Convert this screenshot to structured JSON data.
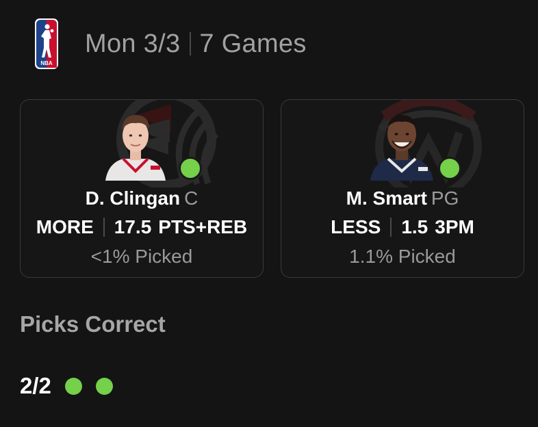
{
  "header": {
    "logo_icon": "nba-logo",
    "date": "Mon 3/3",
    "games": "7 Games"
  },
  "cards": [
    {
      "player_name": "D. Clingan",
      "position": "C",
      "direction": "MORE",
      "line": "17.5",
      "stat": "PTS+REB",
      "picked": "<1% Picked",
      "status": "correct",
      "team_logo_icon": "trail-blazers-pinwheel-logo",
      "status_color": "#75d04a"
    },
    {
      "player_name": "M. Smart",
      "position": "PG",
      "direction": "LESS",
      "line": "1.5",
      "stat": "3PM",
      "picked": "1.1% Picked",
      "status": "correct",
      "team_logo_icon": "wizards-logo",
      "status_color": "#75d04a"
    }
  ],
  "summary": {
    "title": "Picks Correct",
    "score": "2/2",
    "results": [
      "correct",
      "correct"
    ]
  },
  "colors": {
    "background": "#141414",
    "card_border": "#3a3a3a",
    "correct": "#75d04a",
    "muted_text": "#9a9a9a"
  }
}
